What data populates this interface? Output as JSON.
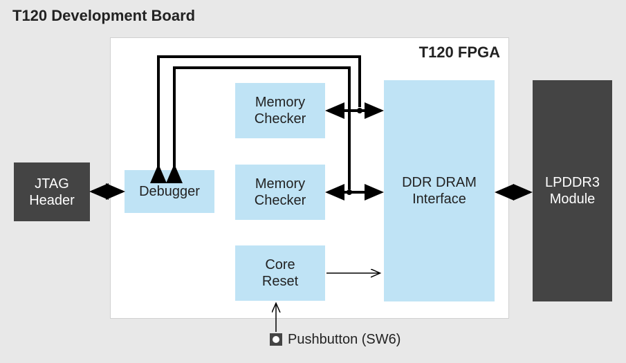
{
  "board": {
    "title": "T120 Development Board"
  },
  "fpga": {
    "title": "T120 FPGA"
  },
  "blocks": {
    "jtag": "JTAG\nHeader",
    "debugger": "Debugger",
    "memchecker1": "Memory\nChecker",
    "memchecker2": "Memory\nChecker",
    "corereset": "Core\nReset",
    "ddr": "DDR DRAM\nInterface",
    "lpddr3": "LPDDR3\nModule"
  },
  "pushbutton": {
    "label": "Pushbutton (SW6)"
  },
  "connections": [
    {
      "from": "jtag",
      "to": "debugger",
      "bidirectional": true
    },
    {
      "from": "debugger",
      "to": "memchecker1",
      "via": "top-bus"
    },
    {
      "from": "debugger",
      "to": "memchecker2",
      "via": "top-bus"
    },
    {
      "from": "memchecker1",
      "to": "ddr",
      "bidirectional": true
    },
    {
      "from": "memchecker2",
      "to": "ddr",
      "bidirectional": true
    },
    {
      "from": "corereset",
      "to": "ddr"
    },
    {
      "from": "ddr",
      "to": "lpddr3",
      "bidirectional": true
    },
    {
      "from": "pushbutton",
      "to": "corereset"
    }
  ]
}
